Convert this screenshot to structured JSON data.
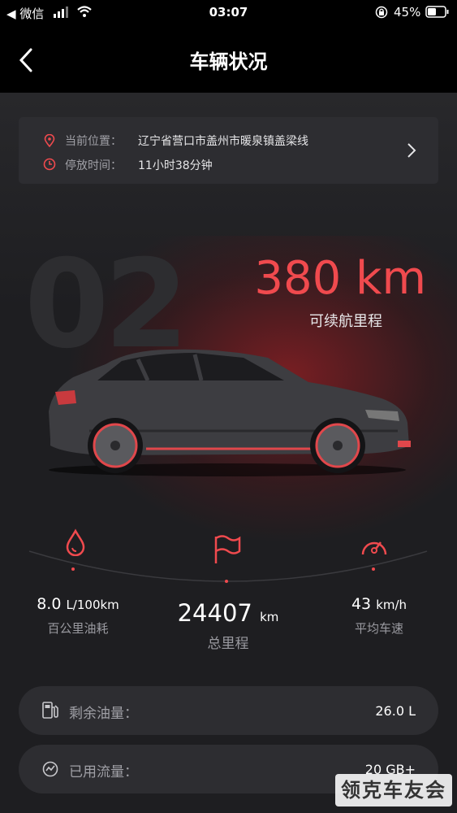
{
  "status_bar": {
    "back_app": "◀ 微信",
    "time": "03:07",
    "battery": "45%"
  },
  "header": {
    "title": "车辆状况"
  },
  "location_card": {
    "location_label": "当前位置：",
    "location_value": "辽宁省营口市盖州市暖泉镇盖梁线",
    "parked_label": "停放时间：",
    "parked_value": "11小时38分钟"
  },
  "hero": {
    "model_number": "02",
    "range_value": "380 km",
    "range_label": "可续航里程"
  },
  "stats": {
    "fuel_consumption": {
      "value": "8.0",
      "unit": "L/100km",
      "label": "百公里油耗"
    },
    "mileage": {
      "value": "24407",
      "unit": "km",
      "label": "总里程"
    },
    "avg_speed": {
      "value": "43",
      "unit": "km/h",
      "label": "平均车速"
    }
  },
  "info_rows": [
    {
      "label": "剩余油量：",
      "value": "26.0 L",
      "icon": "fuel-pump-icon"
    },
    {
      "label": "已用流量：",
      "value": "20 GB+",
      "icon": "data-usage-icon"
    }
  ],
  "watermark": {
    "text": "领克车友会"
  },
  "colors": {
    "accent": "#f04a4e",
    "background": "#1e1e21",
    "card": "#2d2d31"
  }
}
